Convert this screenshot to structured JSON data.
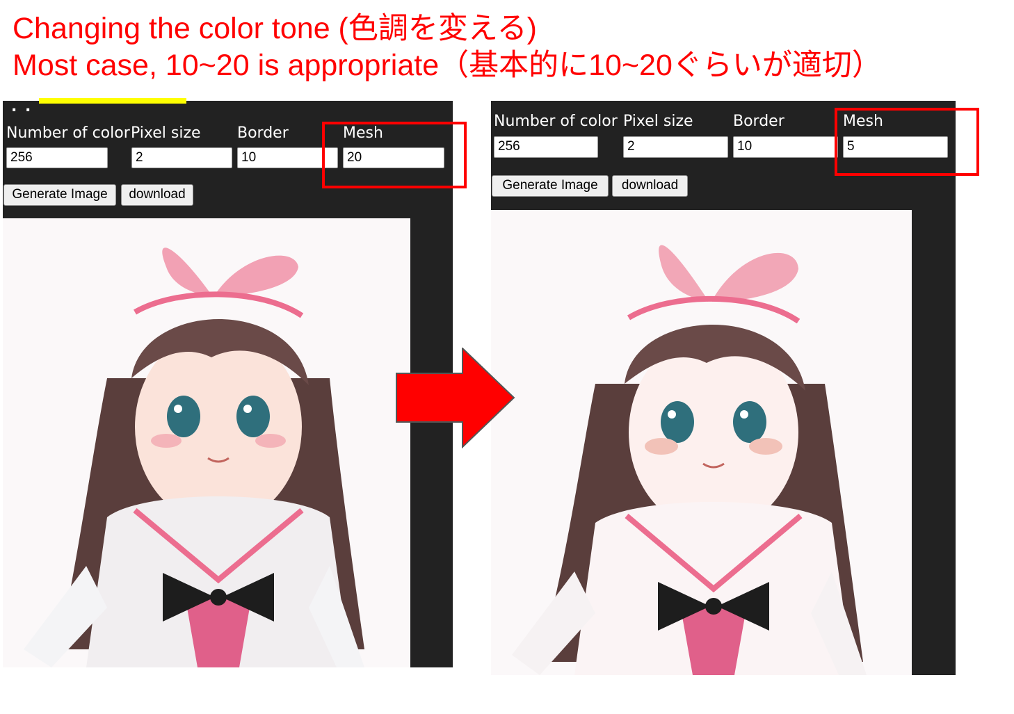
{
  "captions": {
    "line1": "Changing the color tone (色調を変える)",
    "line2": "Most case, 10~20 is appropriate（基本的に10~20ぐらいが適切）"
  },
  "left": {
    "labels": {
      "colors": "Number of color",
      "pixel": "Pixel size",
      "border": "Border",
      "mesh": "Mesh"
    },
    "values": {
      "colors": "256",
      "pixel": "2",
      "border": "10",
      "mesh": "20"
    },
    "buttons": {
      "generate": "Generate Image",
      "download": "download"
    }
  },
  "right": {
    "labels": {
      "colors": "Number of color",
      "pixel": "Pixel size",
      "border": "Border",
      "mesh": "Mesh"
    },
    "values": {
      "colors": "256",
      "pixel": "2",
      "border": "10",
      "mesh": "5"
    },
    "buttons": {
      "generate": "Generate Image",
      "download": "download"
    }
  },
  "colors": {
    "annotation": "#ff0000",
    "panel": "#222222",
    "highlight": "#ffff00"
  },
  "icons": {
    "arrow": "right-arrow-icon"
  }
}
